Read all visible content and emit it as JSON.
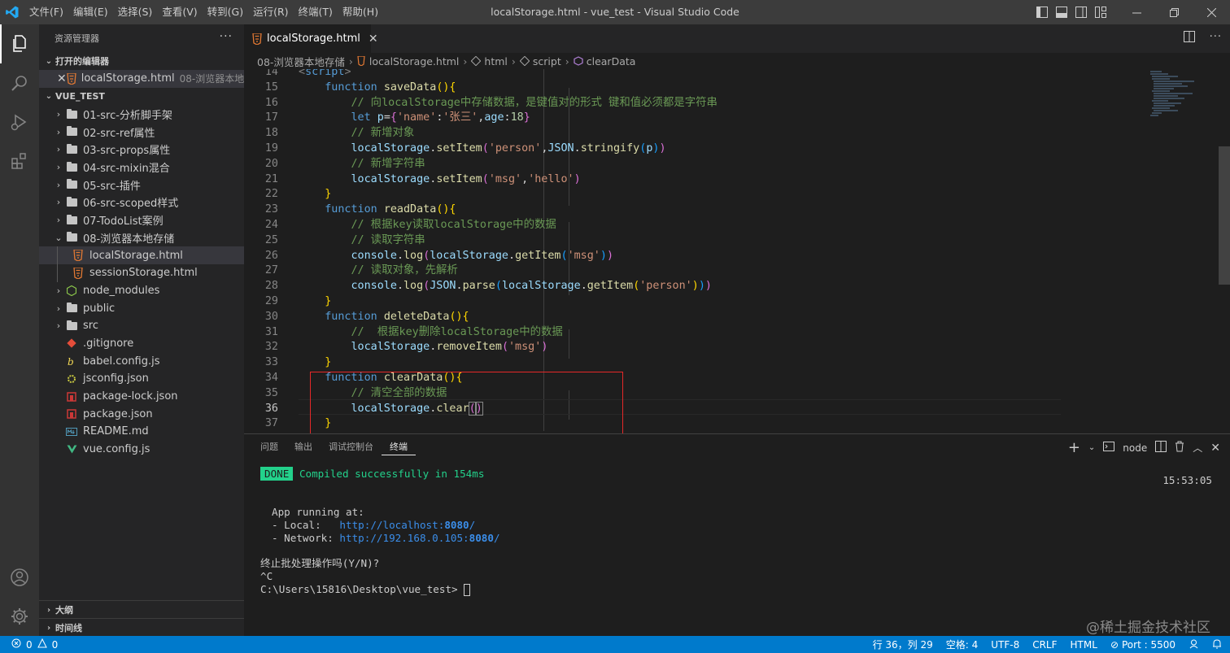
{
  "titlebar": {
    "menu": [
      "文件(F)",
      "编辑(E)",
      "选择(S)",
      "查看(V)",
      "转到(G)",
      "运行(R)",
      "终端(T)",
      "帮助(H)"
    ],
    "title": "localStorage.html - vue_test - Visual Studio Code"
  },
  "sidebar": {
    "header": "资源管理器",
    "open_editors_label": "打开的编辑器",
    "open_editor": {
      "name": "localStorage.html",
      "desc": "08-浏览器本地..."
    },
    "project_label": "VUE_TEST",
    "folders": [
      "01-src-分析脚手架",
      "02-src-ref属性",
      "03-src-props属性",
      "04-src-mixin混合",
      "05-src-插件",
      "06-src-scoped样式",
      "07-TodoList案例",
      "08-浏览器本地存储"
    ],
    "sub_files": [
      "localStorage.html",
      "sessionStorage.html"
    ],
    "root_folders": [
      "node_modules",
      "public",
      "src"
    ],
    "root_files": [
      ".gitignore",
      "babel.config.js",
      "jsconfig.json",
      "package-lock.json",
      "package.json",
      "README.md",
      "vue.config.js"
    ],
    "outline_label": "大纲",
    "timeline_label": "时间线"
  },
  "editor": {
    "tab_label": "localStorage.html",
    "breadcrumb": [
      "08-浏览器本地存储",
      "localStorage.html",
      "html",
      "script",
      "clearData"
    ],
    "current_line": 36
  },
  "panel": {
    "tabs": [
      "问题",
      "输出",
      "调试控制台",
      "终端"
    ],
    "active_tab": "终端",
    "shell": "node",
    "done_badge": "DONE",
    "compiled": "Compiled successfully in 154ms",
    "time": "15:53:05",
    "running": "App running at:",
    "local_label": "- Local:   ",
    "local_url_a": "http://localhost:",
    "local_port": "8080",
    "network_label": "- Network: ",
    "network_url_a": "http://192.168.0.105:",
    "network_port": "8080",
    "url_tail": "/",
    "prompt_q": "终止批处理操作吗(Y/N)?",
    "ctrl_c": "^C",
    "cwd": "C:\\Users\\15816\\Desktop\\vue_test>"
  },
  "statusbar": {
    "errors": "0",
    "warnings": "0",
    "position": "行 36，列 29",
    "spaces": "空格: 4",
    "encoding": "UTF-8",
    "eol": "CRLF",
    "language": "HTML",
    "port": "Port : 5500"
  },
  "watermark": "@稀土掘金技术社区",
  "colors": {
    "accent": "#007acc",
    "highlight_box": "#e52828",
    "done": "#23d18b"
  }
}
